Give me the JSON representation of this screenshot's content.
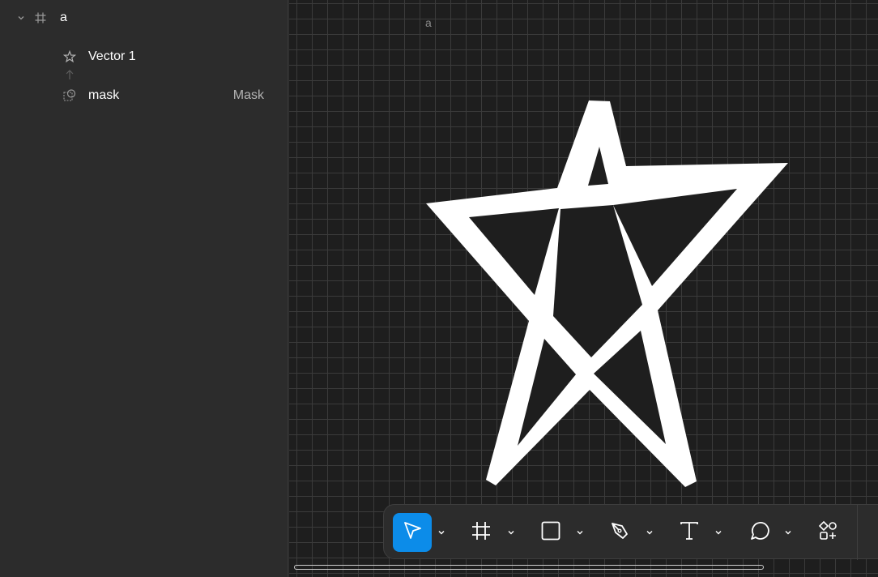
{
  "layers": {
    "frame": {
      "name": "a",
      "icon": "frame-hash-icon",
      "expand_icon": "chevron-down-icon"
    },
    "children": [
      {
        "name": "Vector 1",
        "icon": "star-vector-icon",
        "badge": ""
      },
      {
        "name": "mask",
        "icon": "mask-shape-icon",
        "badge": "Mask"
      }
    ],
    "mask_arrow_icon": "arrow-up-icon"
  },
  "canvas": {
    "frame_label": "a",
    "star": {
      "stroke": "#ffffff",
      "background": "#1e1e1e"
    },
    "grid_color": "#3b3b3b"
  },
  "toolbar": {
    "accent": "#0c8ce9",
    "tools": [
      {
        "name": "move",
        "icon": "cursor-arrow-icon",
        "active": true
      },
      {
        "name": "frame",
        "icon": "frame-hash-icon",
        "active": false
      },
      {
        "name": "rectangle",
        "icon": "rectangle-icon",
        "active": false
      },
      {
        "name": "pen",
        "icon": "pen-nib-icon",
        "active": false
      },
      {
        "name": "text",
        "icon": "text-t-icon",
        "active": false
      },
      {
        "name": "comment",
        "icon": "comment-bubble-icon",
        "active": false
      },
      {
        "name": "actions",
        "icon": "shapes-plus-icon",
        "active": false
      }
    ]
  }
}
